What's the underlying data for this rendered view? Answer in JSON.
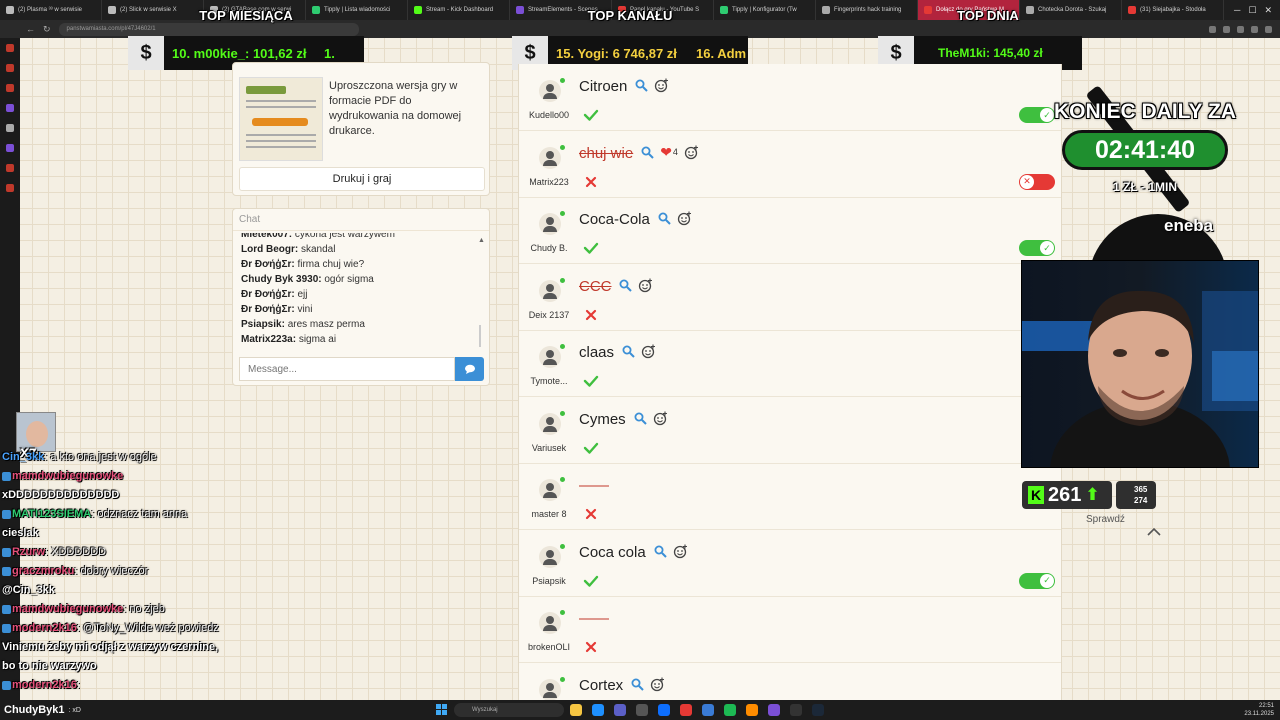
{
  "browser": {
    "tabs": [
      {
        "label": "(2) Plasma ³³ w serwisie",
        "color": "#bbbbbb"
      },
      {
        "label": "(2) Slick w serwisie X",
        "color": "#bbbbbb"
      },
      {
        "label": "(2) GTABase.com w serwi",
        "color": "#bbbbbb"
      },
      {
        "label": "Tipply | Lista wiadomości",
        "color": "#2ecc71"
      },
      {
        "label": "Stream - Kick Dashboard",
        "color": "#53fc18"
      },
      {
        "label": "StreamElements - Scenes",
        "color": "#7b4fd6"
      },
      {
        "label": "Panel kanału - YouTube S",
        "color": "#e53935"
      },
      {
        "label": "Tipply | Konfigurator (Tw",
        "color": "#2ecc71"
      },
      {
        "label": "Fingerprints hack training",
        "color": "#aaaaaa"
      },
      {
        "label": "Dołącz do gry Państwa M",
        "color": "#e53935"
      },
      {
        "label": "Chotecka Dorota - Szukaj",
        "color": "#aaaaaa"
      },
      {
        "label": "(31) Siejabajka - Stodoła",
        "color": "#e53935"
      }
    ],
    "active_tab_index": 9,
    "url": "panstwamiasta.com/pl/47J4602/1"
  },
  "overlay": {
    "top_month": {
      "title": "TOP MIESIĄCA",
      "entry": "10. m00kie_: 101,62 zł",
      "next": "1."
    },
    "top_channel": {
      "title": "TOP KANAŁU",
      "entry": "15. Yogi: 6 746,87 zł",
      "next": "16. Adm"
    },
    "top_day": {
      "title": "TOP DNIA",
      "entry": "TheM1ki: 145,40 zł"
    },
    "dollar_symbol": "$",
    "daily": {
      "title": "KONIEC DAILY ZA",
      "timer": "02:41:40",
      "sub": "1 ZŁ - 1MIN"
    },
    "sponsor": "eneba",
    "kick": {
      "followers": "261",
      "viewers_a": "365",
      "viewers_b": "274"
    },
    "sprawdz": "Sprawdź",
    "xz_label": "xz",
    "accent_green": "#53fc18"
  },
  "print_card": {
    "text": "Uproszczona wersja gry w formacie PDF do wydrukowania na domowej drukarce.",
    "button": "Drukuj i graj"
  },
  "chat": {
    "header": "Chat",
    "messages": [
      {
        "user": "Mietek007:",
        "text": "cykoria jest warzywem"
      },
      {
        "user": "Lord Beogr:",
        "text": "skandal"
      },
      {
        "user": "Đr ĐơήģΣr:",
        "text": "firma chuj wie?"
      },
      {
        "user": "Chudy Byk 3930:",
        "text": "ogór sigma"
      },
      {
        "user": "Đr ĐơήģΣr:",
        "text": "ejj"
      },
      {
        "user": "Đr ĐơήģΣr:",
        "text": "vini"
      },
      {
        "user": "Psiapsik:",
        "text": "ares masz perma"
      },
      {
        "user": "Matrix223a:",
        "text": "sigma ai"
      }
    ],
    "placeholder": "Message..."
  },
  "answers": [
    {
      "word": "Citroen",
      "player": "Kudello00",
      "status": "ok",
      "toggle": "on",
      "struck": false,
      "hearts": ""
    },
    {
      "word": "chuj wie",
      "player": "Matrix223",
      "status": "bad",
      "toggle": "off",
      "struck": true,
      "hearts": "4"
    },
    {
      "word": "Coca-Cola",
      "player": "Chudy B.",
      "status": "ok",
      "toggle": "on",
      "struck": false,
      "hearts": ""
    },
    {
      "word": "CCC",
      "player": "Deix 2137",
      "status": "bad",
      "toggle": "",
      "struck": true,
      "hearts": ""
    },
    {
      "word": "claas",
      "player": "Tymote...",
      "status": "ok",
      "toggle": "",
      "struck": false,
      "hearts": ""
    },
    {
      "word": "Cymes",
      "player": "Variusek",
      "status": "ok",
      "toggle": "",
      "struck": false,
      "hearts": ""
    },
    {
      "word": "——",
      "player": "master 8",
      "status": "bad",
      "toggle": "",
      "struck": false,
      "blank": true,
      "hearts": ""
    },
    {
      "word": "Coca cola",
      "player": "Psiapsik",
      "status": "ok",
      "toggle": "on",
      "struck": false,
      "hearts": ""
    },
    {
      "word": "——",
      "player": "brokenOLI",
      "status": "bad",
      "toggle": "",
      "struck": false,
      "blank": true,
      "hearts": ""
    },
    {
      "word": "Cortex",
      "player": "",
      "status": "",
      "toggle": "",
      "struck": false,
      "hearts": ""
    }
  ],
  "stream_chat": [
    {
      "user": "Cin_3kk",
      "msg": ": a kto ona jest w ogóle",
      "color": "#4aa3ff"
    },
    {
      "user": "mamdwubiegunowke",
      "msg": "",
      "color": "#e5507a"
    },
    {
      "user": "xDDDDDDDDDDDDDD",
      "msg": "",
      "color": "#ffffff"
    },
    {
      "user": "MATI123SIEMA",
      "msg": ": odznacz tam anna",
      "color": "#2ecc71"
    },
    {
      "user": "cieslak",
      "msg": "",
      "color": "#ffffff"
    },
    {
      "user": "Rzurw",
      "msg": ": XDDDDDD",
      "color": "#e5507a"
    },
    {
      "user": "graczmroku",
      "msg": ": dobry wieczór",
      "color": "#e5507a"
    },
    {
      "user": "@Cin_3kk",
      "msg": "",
      "color": "#ffffff"
    },
    {
      "user": "mamdwubiegunowke",
      "msg": ": no zjeb",
      "color": "#e5507a"
    },
    {
      "user": "modern2k16",
      "msg": ": @ToNy_Wilde weź powiedz",
      "color": "#e5507a"
    },
    {
      "user": "Viniemu żeby mi odjął z warzyw czernine,",
      "msg": "",
      "color": "#ffffff"
    },
    {
      "user": "bo to nie warzywo",
      "msg": "",
      "color": "#ffffff"
    },
    {
      "user": "modern2k16",
      "msg": ":",
      "color": "#e5507a"
    }
  ],
  "taskbar": {
    "viewer_name": "ChudyByk1",
    "viewer_suffix": ": xD",
    "search": "Wyszukaj",
    "time": "22:51",
    "date": "23.11.2025"
  }
}
